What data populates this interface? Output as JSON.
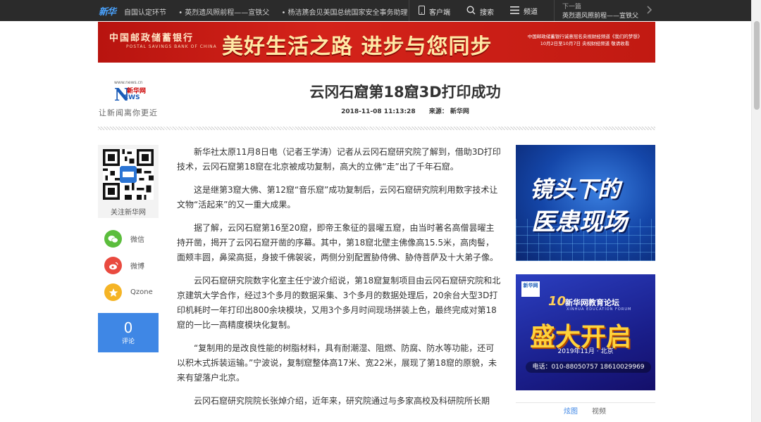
{
  "topbar": {
    "logo_main": "新华",
    "logo_accent": "",
    "ticker": [
      "自国认定环节",
      "• 英烈遗风照前程——宣铁父",
      "• 杨洁篪会见美国总统国家安全事务助理"
    ],
    "client_label": "客户端",
    "search_label": "搜索",
    "channel_label": "频道",
    "next_label": "下一篇",
    "next_title": "英烈遗风照前程——宣铁父"
  },
  "banner": {
    "bank_name": "中国邮政储蓄银行",
    "bank_en": "POSTAL SAVINGS BANK OF CHINA",
    "slogan": "美好生活之路 进步与您同步",
    "side_line1": "中国邮政储蓄银行诚意冠名央视财经频道《我们的梦想》",
    "side_line2": "10月2日至10月7日 央视财经频道 敬请收看"
  },
  "header": {
    "site_url": "www.news.cn",
    "logo_letter": "N",
    "logo_suffix": "EWS",
    "logo_cn": "新华网",
    "motto": "让新闻离你更近",
    "title": "云冈石窟第18窟3D打印成功",
    "datetime": "2018-11-08 11:13:28",
    "source": "来源： 新华网"
  },
  "left": {
    "qr_label": "关注新华网",
    "share": [
      {
        "label": "微信",
        "color": "#5bbd3c"
      },
      {
        "label": "微博",
        "color": "#e94a3f"
      },
      {
        "label": "Qzone",
        "color": "#f5b425"
      }
    ],
    "comment_count": "0",
    "comment_label": "评论"
  },
  "article": {
    "paragraphs": [
      "新华社太原11月8日电（记者王学涛）记者从云冈石窟研究院了解到，借助3D打印技术，云冈石窟第18窟在北京被成功复制，高大的立佛“走”出了千年石窟。",
      "这是继第3窟大佛、第12窟“音乐窟”成功复制后，云冈石窟研究院利用数字技术让文物“活起来”的又一重大成果。",
      "据了解，云冈石窟第16至20窟，即帝王象征的昙曜五窟，由当时著名高僧昙曜主持开凿，揭开了云冈石窟开凿的序幕。其中，第18窟北壁主佛像高15.5米，高肉髻，面颊丰圆，鼻梁高挺，身披千佛袈裟，两侧分别配置胁侍佛、胁侍菩萨及十大弟子像。",
      "云冈石窟研究院数字化室主任宁波介绍说，第18窟复制项目由云冈石窟研究院和北京建筑大学合作，经过3个多月的数据采集、3个多月的数据处理后，20余台大型3D打印机耗时一年打印出800余块模块，又用3个多月时间现场拼装上色，最终完成对第18窟的一比一高精度模块化复制。",
      "“复制用的是改良性能的树脂材料，具有耐潮湿、阻燃、防腐、防水等功能，还可以积木式拆装运输。”宁波说，复制窟整体高17米、宽22米，展现了第18窟的原貌，未来有望落户北京。",
      "云冈石窟研究院院长张焯介绍，近年来，研究院通过与多家高校及科研院所长期"
    ]
  },
  "right": {
    "ad1_line1": "镜头下的",
    "ad1_line2": "医患现场",
    "ad2_logo": "新华网",
    "ad2_num": "10",
    "ad2_forum": "新华网教育论坛",
    "ad2_forum_en": "XINHUA EDUCATION FORUM",
    "ad2_big": "盛大开启",
    "ad2_date": "2019年11月 · 北京",
    "ad2_phone": "电话：010-88050757  18610029969",
    "tab_active": "炫图",
    "tab_other": "视频"
  }
}
